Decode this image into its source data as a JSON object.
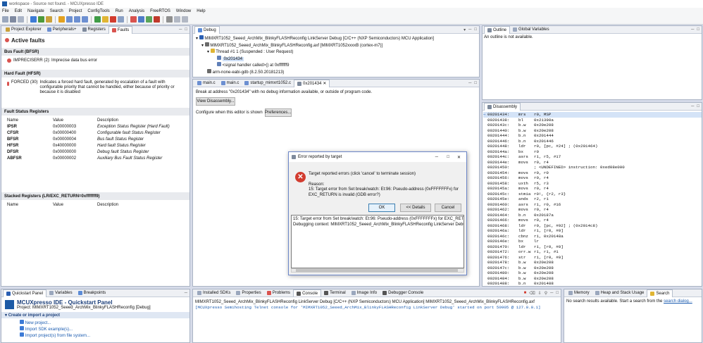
{
  "window": {
    "title": "workspace - Source not found. - MCUXpresso IDE"
  },
  "menu": [
    "File",
    "Edit",
    "Navigate",
    "Search",
    "Project",
    "ConfigTools",
    "Run",
    "Analysis",
    "FreeRTOS",
    "Window",
    "Help"
  ],
  "left_panel": {
    "tabs": [
      "Project Explorer",
      "Peripherals+",
      "Registers",
      "Faults"
    ],
    "title": "Active faults",
    "bus_fault_heading": "Bus Fault (BFSR)",
    "bus_fault_item": "IMPRECISERR (2): Imprecise data bus error",
    "hard_fault_heading": "Hard Fault (HFSR)",
    "hard_fault_item": "FORCED (30)",
    "hard_fault_desc": "Indicates a forced hard fault, generated by escalation of a fault with configurable priority that cannot be handled, either because of priority or because it is disabled",
    "fsr_heading": "Fault Status Registers",
    "fsr_columns": [
      "Name",
      "Value",
      "Description"
    ],
    "fsr_rows": [
      {
        "name": "IPSR",
        "value": "0x00000003",
        "desc": "Exception Status Register (Hard Fault)"
      },
      {
        "name": "CFSR",
        "value": "0x00000400",
        "desc": "Configurable fault Status Register"
      },
      {
        "name": "BFSR",
        "value": "0x00000004",
        "desc": "Bus fault Status Register"
      },
      {
        "name": "HFSR",
        "value": "0x40000000",
        "desc": "Hard fault Status Register"
      },
      {
        "name": "DFSR",
        "value": "0x00000000",
        "desc": "Debug fault Status Register"
      },
      {
        "name": "ABFSR",
        "value": "0x00000002",
        "desc": "Auxiliary Bus Fault Status Register"
      }
    ],
    "stacked_heading": "Stacked Registers (LR/EXC_RETURN=0xfffffff9)",
    "stacked_columns": [
      "Name",
      "Value",
      "Description"
    ]
  },
  "debug_panel": {
    "tab": "Debug",
    "launch": "MIMXRT1052_Seeed_ArchMix_BlinkyFLASHReconfig LinkServer Debug [C/C++ (NXP Semiconductors) MCU Application]",
    "axf": "MIMXRT1052_Seeed_ArchMix_BlinkyFLASHReconfig.axf [MIMXRT1052xxxxB (cortex-m7)]",
    "thread": "Thread #1 1 (Suspended : User Request)",
    "frame1": "0x201434",
    "frame2": "<signal handler called>() at 0xfffffff9",
    "gdb": "arm-none-eabi-gdb (8.2.50.20181213)"
  },
  "editor": {
    "tabs": [
      "main.c",
      "main.c",
      "startup_mimxrt1052.c",
      "0x201434"
    ],
    "break_text": "Break at address \"0x201434\" with no debug information available, or outside of program code.",
    "view_disassembly": "View Disassembly...",
    "configure_text": "Configure when this editor is shown",
    "preferences": "Preferences..."
  },
  "outline": {
    "tabs": [
      "Outline",
      "Global Variables"
    ],
    "message": "An outline is not available."
  },
  "disassembly": {
    "tab": "Disassembly",
    "rows": [
      {
        "addr": "00201434:",
        "op": "mrs",
        "args": "r0, MSP"
      },
      {
        "addr": "00201438:",
        "op": "bl",
        "args": "0x21390a"
      },
      {
        "addr": "0020143c:",
        "op": "b.w",
        "args": "0x20e208"
      },
      {
        "addr": "00201440:",
        "op": "b.w",
        "args": "0x20e208"
      },
      {
        "addr": "00201444:",
        "op": "b.n",
        "args": "0x201444"
      },
      {
        "addr": "00201446:",
        "op": "b.n",
        "args": "0x201446"
      },
      {
        "addr": "00201448:",
        "op": "ldr",
        "args": "r0, [pc, #24]    ; (0x201464)"
      },
      {
        "addr": "0020144a:",
        "op": "bx",
        "args": "r0"
      },
      {
        "addr": "0020144c:",
        "op": "asrs",
        "args": "r1, r5, #17"
      },
      {
        "addr": "0020144e:",
        "op": "movs",
        "args": "r0, r4"
      },
      {
        "addr": "00201450:",
        "op": "",
        "args": "; <UNDEFINED> instruction: 0xed08e000"
      },
      {
        "addr": "00201454:",
        "op": "movs",
        "args": "r0, r0"
      },
      {
        "addr": "00201456:",
        "op": "movs",
        "args": "r0, r4"
      },
      {
        "addr": "00201458:",
        "op": "uxth",
        "args": "r5, r3"
      },
      {
        "addr": "0020145a:",
        "op": "movs",
        "args": "r0, r4"
      },
      {
        "addr": "0020145c:",
        "op": "stmia",
        "args": "r0!, {r2, r3}"
      },
      {
        "addr": "0020145e:",
        "op": "ands",
        "args": "r2, r1"
      },
      {
        "addr": "00201460:",
        "op": "asrs",
        "args": "r1, r0, #16"
      },
      {
        "addr": "00201462:",
        "op": "movs",
        "args": "r0, r4"
      },
      {
        "addr": "00201464:",
        "op": "b.n",
        "args": "0x20187a"
      },
      {
        "addr": "00201466:",
        "op": "movs",
        "args": "r0, r4"
      },
      {
        "addr": "00201468:",
        "op": "ldr",
        "args": "r0, [pc, #92]    ; (0x2014c8)"
      },
      {
        "addr": "0020146a:",
        "op": "ldr",
        "args": "r1, [r0, #0]"
      },
      {
        "addr": "0020146c:",
        "op": "cbnz",
        "args": "r1, 0x20148a"
      },
      {
        "addr": "0020146e:",
        "op": "bx",
        "args": "lr"
      },
      {
        "addr": "00201470:",
        "op": "ldr",
        "args": "r1, [r0, #0]"
      },
      {
        "addr": "00201472:",
        "op": "orr.w",
        "args": "r1, r1, #1"
      },
      {
        "addr": "00201476:",
        "op": "str",
        "args": "r1, [r0, #0]"
      },
      {
        "addr": "00201478:",
        "op": "b.w",
        "args": "0x20e208"
      },
      {
        "addr": "0020147c:",
        "op": "b.w",
        "args": "0x20e208"
      },
      {
        "addr": "00201480:",
        "op": "b.w",
        "args": "0x20e208"
      },
      {
        "addr": "00201484:",
        "op": "b.w",
        "args": "0x20e208"
      },
      {
        "addr": "00201488:",
        "op": "b.n",
        "args": "0x201488"
      }
    ]
  },
  "dialog": {
    "title": "Error reported by target",
    "message": "Target reported errors (click 'cancel' to terminate session)",
    "reason_label": "Reason:",
    "reason": "15: Target error from Set break/watch: Et:96: Pseudo-address (0xFFFFFFFx) for EXC_RETURN is invalid (GDB error?)",
    "details_line1": "15: Target error from Set break/watch: Et:96: Pseudo-address (0xFFFFFFFx) for EXC_RETURN is in",
    "details_line2": "Debugging context: MIMXRT1052_Seeed_ArchMix_BlinkyFLASHReconfig LinkServer Debug",
    "ok": "OK",
    "details": "<< Details",
    "cancel": "Cancel"
  },
  "quickstart": {
    "tabs": [
      "Quickstart Panel",
      "Variables",
      "Breakpoints"
    ],
    "title": "MCUXpresso IDE - Quickstart Panel",
    "project": "Project: MIMXRT1052_Seeed_ArchMix_BlinkyFLASHReconfig [Debug]",
    "section": "Create or import a project",
    "items": [
      "New project...",
      "Import SDK example(s)...",
      "Import project(s) from file system..."
    ]
  },
  "console": {
    "tabs": [
      "Installed SDKs",
      "Properties",
      "Problems",
      "Console",
      "Terminal",
      "Image Info",
      "Debugger Console"
    ],
    "line1": "MIMXRT1052_Seeed_ArchMix_BlinkyFLASHReconfig LinkServer Debug [C/C++ (NXP Semiconductors) MCU Application] MIMXRT1052_Seeed_ArchMix_BlinkyFLASHReconfig.axf",
    "line2": "[MCUXpresso Semihosting Telnet console for 'MIMXRT1052_Seeed_ArchMix_BlinkyFLASHReconfig LinkServer Debug' started on port 50905 @ 127.0.0.1]"
  },
  "search": {
    "tabs": [
      "Memory",
      "Heap and Stack Usage",
      "Search"
    ],
    "message": "No search results available. Start a search from the",
    "link": "search dialog..."
  }
}
